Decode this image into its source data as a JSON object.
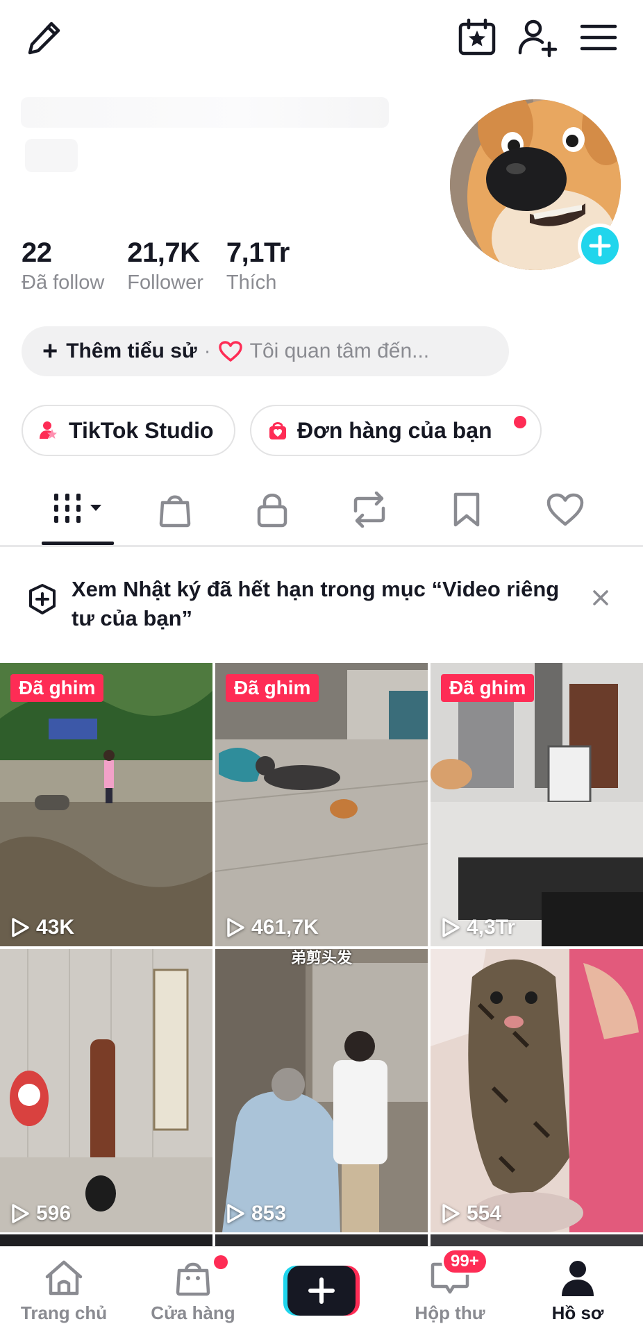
{
  "header": {
    "icons": [
      "edit-pencil-icon",
      "calendar-star-icon",
      "add-friend-icon",
      "menu-icon"
    ]
  },
  "profile": {
    "stats": [
      {
        "value": "22",
        "label": "Đã follow"
      },
      {
        "value": "21,7K",
        "label": "Follower"
      },
      {
        "value": "7,1Tr",
        "label": "Thích"
      }
    ],
    "bio_add_label": "Thêm tiểu sử",
    "bio_separator": "·",
    "interest_placeholder": "Tôi quan tâm đến..."
  },
  "chips": {
    "studio_label": "TikTok Studio",
    "orders_label": "Đơn hàng của bạn"
  },
  "tabs": [
    "videos-grid-tab",
    "shop-tab",
    "private-tab",
    "repost-tab",
    "favorites-tab",
    "liked-tab"
  ],
  "notice": {
    "text": "Xem Nhật ký đã hết hạn trong mục “Video riêng tư của bạn”"
  },
  "videos": [
    {
      "pinned": "Đã ghim",
      "views": "43K"
    },
    {
      "pinned": "Đã ghim",
      "views": "461,7K"
    },
    {
      "pinned": "Đã ghim",
      "views": "4,3Tr"
    },
    {
      "views": "596"
    },
    {
      "views": "853",
      "caption": "弟剪头发"
    },
    {
      "views": "554"
    }
  ],
  "nav": {
    "home": "Trang chủ",
    "shop": "Cửa hàng",
    "inbox": "Hộp thư",
    "inbox_badge": "99+",
    "profile": "Hồ sơ"
  },
  "colors": {
    "accent_red": "#fe2c55",
    "accent_cyan": "#20d5ec",
    "text_primary": "#161823",
    "text_secondary": "#8a8b91"
  }
}
